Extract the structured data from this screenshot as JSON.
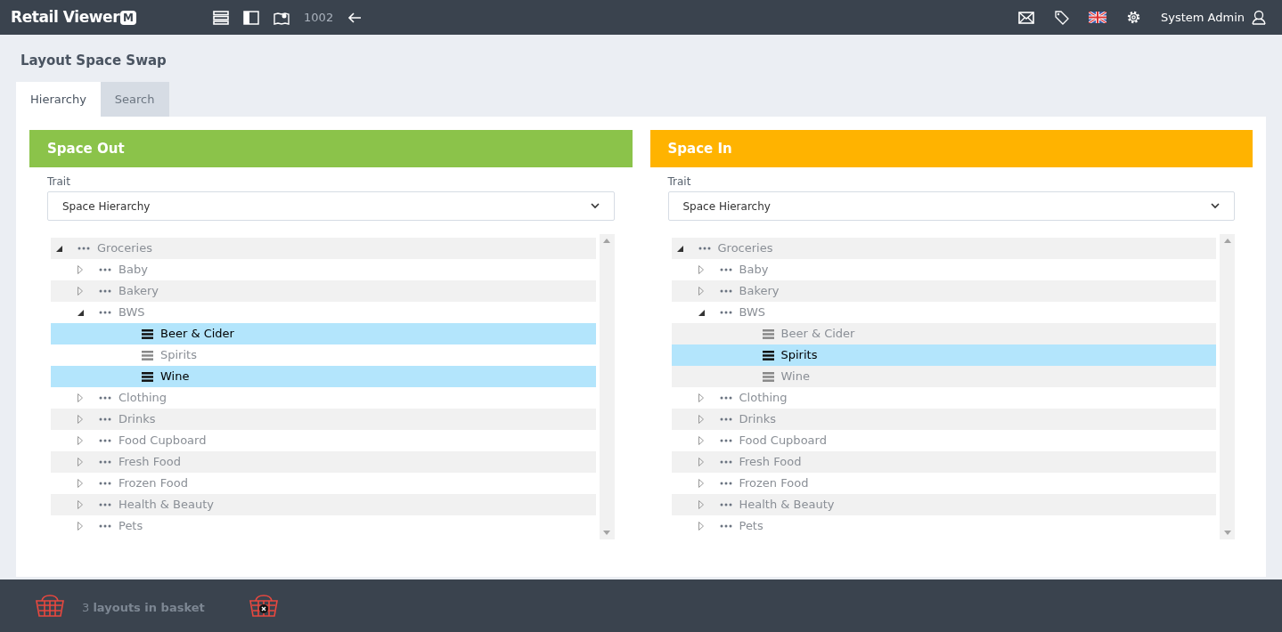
{
  "header": {
    "logo": "Retail Viewer",
    "logo_badge": "M",
    "store_number": "1002",
    "user": "System Admin"
  },
  "page_title": "Layout Space Swap",
  "tabs": [
    {
      "label": "Hierarchy",
      "selected": true
    },
    {
      "label": "Search",
      "selected": false
    }
  ],
  "panels": [
    {
      "title": "Space Out",
      "color": "#8bc34a",
      "trait_label": "Trait",
      "trait_value": "Space Hierarchy",
      "tree": [
        {
          "label": "Groceries",
          "kind": "group",
          "expanded": true,
          "children": [
            {
              "label": "Baby",
              "kind": "group",
              "expanded": false
            },
            {
              "label": "Bakery",
              "kind": "group",
              "expanded": false
            },
            {
              "label": "BWS",
              "kind": "group",
              "expanded": true,
              "children": [
                {
                  "label": "Beer & Cider",
                  "kind": "leaf",
                  "selected": true
                },
                {
                  "label": "Spirits",
                  "kind": "leaf",
                  "selected": false
                },
                {
                  "label": "Wine",
                  "kind": "leaf",
                  "selected": true
                }
              ]
            },
            {
              "label": "Clothing",
              "kind": "group",
              "expanded": false
            },
            {
              "label": "Drinks",
              "kind": "group",
              "expanded": false
            },
            {
              "label": "Food Cupboard",
              "kind": "group",
              "expanded": false
            },
            {
              "label": "Fresh Food",
              "kind": "group",
              "expanded": false
            },
            {
              "label": "Frozen Food",
              "kind": "group",
              "expanded": false
            },
            {
              "label": "Health & Beauty",
              "kind": "group",
              "expanded": false
            },
            {
              "label": "Pets",
              "kind": "group",
              "expanded": false
            }
          ]
        }
      ]
    },
    {
      "title": "Space In",
      "color": "#ffb300",
      "trait_label": "Trait",
      "trait_value": "Space Hierarchy",
      "tree": [
        {
          "label": "Groceries",
          "kind": "group",
          "expanded": true,
          "children": [
            {
              "label": "Baby",
              "kind": "group",
              "expanded": false
            },
            {
              "label": "Bakery",
              "kind": "group",
              "expanded": false
            },
            {
              "label": "BWS",
              "kind": "group",
              "expanded": true,
              "children": [
                {
                  "label": "Beer & Cider",
                  "kind": "leaf",
                  "selected": false
                },
                {
                  "label": "Spirits",
                  "kind": "leaf",
                  "selected": true
                },
                {
                  "label": "Wine",
                  "kind": "leaf",
                  "selected": false
                }
              ]
            },
            {
              "label": "Clothing",
              "kind": "group",
              "expanded": false
            },
            {
              "label": "Drinks",
              "kind": "group",
              "expanded": false
            },
            {
              "label": "Food Cupboard",
              "kind": "group",
              "expanded": false
            },
            {
              "label": "Fresh Food",
              "kind": "group",
              "expanded": false
            },
            {
              "label": "Frozen Food",
              "kind": "group",
              "expanded": false
            },
            {
              "label": "Health & Beauty",
              "kind": "group",
              "expanded": false
            },
            {
              "label": "Pets",
              "kind": "group",
              "expanded": false
            }
          ]
        }
      ]
    }
  ],
  "basket": {
    "text": "3 **layouts in basket**"
  }
}
